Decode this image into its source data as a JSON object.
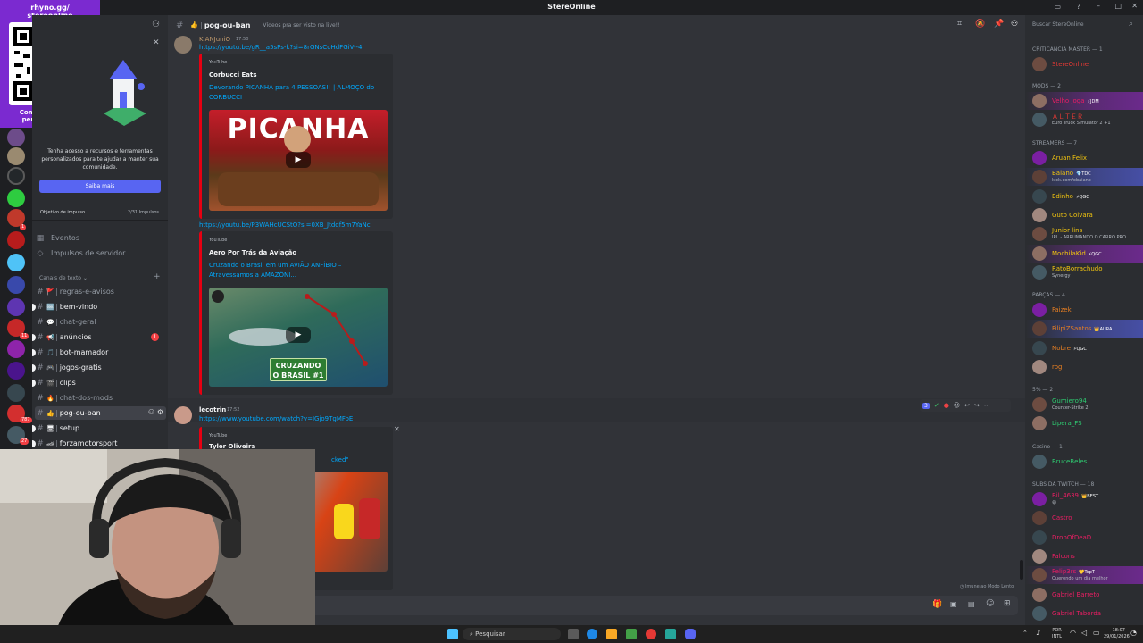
{
  "window": {
    "title": "StereOnline"
  },
  "qr": {
    "line1": "rhyno.gg/",
    "line2": "stereonline",
    "cta": "Compre produtos personalizados!"
  },
  "server_badges": [
    "1",
    "11",
    "787",
    "27"
  ],
  "sidebar": {
    "promo_text": "Tenha acesso a recursos e ferramentas personalizados para te ajudar a manter sua comunidade.",
    "promo_button": "Saiba mais",
    "boost_goal_label": "Objetivo de impulso",
    "boost_goal_value": "2/31 Impulsos",
    "events": "Eventos",
    "server_boosts": "Impulsos de servidor",
    "category": "Canais de texto",
    "channels": [
      {
        "name": "regras-e-avisos",
        "emoji": "🚩",
        "state": "read"
      },
      {
        "name": "bem-vindo",
        "emoji": "🆒",
        "state": "unread"
      },
      {
        "name": "chat-geral",
        "emoji": "💬",
        "state": "read"
      },
      {
        "name": "anúncios",
        "emoji": "📢",
        "state": "unread",
        "badge": "1"
      },
      {
        "name": "bot-mamador",
        "emoji": "🎵",
        "state": "unread"
      },
      {
        "name": "jogos-gratis",
        "emoji": "🎮",
        "state": "unread"
      },
      {
        "name": "clips",
        "emoji": "🎬",
        "state": "unread"
      },
      {
        "name": "chat-dos-mods",
        "emoji": "🔥",
        "state": "read"
      },
      {
        "name": "pog-ou-ban",
        "emoji": "👍",
        "state": "active"
      },
      {
        "name": "setup",
        "emoji": "🖥",
        "state": "unread"
      },
      {
        "name": "forzamotorsport",
        "emoji": "🏎",
        "state": "unread"
      }
    ]
  },
  "header": {
    "channel": "pog-ou-ban",
    "topic": "Vídeos pra ser visto na live!!",
    "search_placeholder": "Buscar StereOnline"
  },
  "messages": [
    {
      "author": "KIANJuniO",
      "time": "17:50",
      "link1": "https://youtu.be/gR__a5sPs-k?si=8rGNsCoHdFGiV--4",
      "embed1": {
        "provider": "YouTube",
        "channel": "Corbucci Eats",
        "title": "Devorando PICANHA para 4 PESSOAS!! | ALMOÇO do CORBUCCI",
        "thumb_text": "PICANHA"
      },
      "link2": "https://youtu.be/P3WAHcUCStQ?si=0XB_Jtdqf5m7YaNc",
      "embed2": {
        "provider": "YouTube",
        "channel": "Aero Por Trás da Aviação",
        "title": "Cruzando o Brasil em um AVIÃO ANFÍBIO – Atravessamos a AMAZÔNI...",
        "thumb_text1": "CRUZANDO",
        "thumb_text2": "O BRASIL #1"
      }
    },
    {
      "author": "lecotrin",
      "time": "17:52",
      "link1": "https://www.youtube.com/watch?v=IGjo9TgMFoE",
      "embed1": {
        "provider": "YouTube",
        "channel": "Tyler Oliveira",
        "title_fragment": "cked\""
      }
    }
  ],
  "reaction_counter": "3",
  "slow_mode": "Imune ao Modo Lento",
  "members": {
    "sections": [
      {
        "label": "CRITICANCIA MASTER — 1",
        "members": [
          {
            "name": "StereOnline",
            "color": "#e53935"
          }
        ]
      },
      {
        "label": "MODS — 2",
        "members": [
          {
            "name": "Velho Joga",
            "color": "#e91e63",
            "badge": "⚡JDM",
            "style": "boostp"
          },
          {
            "name": "ＡＬＴＥＲ",
            "color": "#e53935",
            "status": "Euro Truck Simulator 2 +1"
          }
        ]
      },
      {
        "label": "STREAMERS — 7",
        "members": [
          {
            "name": "Aruan Felix",
            "color": "#f1c40f"
          },
          {
            "name": "Baiano",
            "color": "#f1c40f",
            "badge": "💎TDC",
            "status": "kick.com/obaiano",
            "style": "boost"
          },
          {
            "name": "Edinho",
            "color": "#f1c40f",
            "badge": "⚡QGC"
          },
          {
            "name": "Guto Colvara",
            "color": "#f1c40f"
          },
          {
            "name": "Junior lins",
            "color": "#f1c40f",
            "status": "IRL - ARRUMANDO O CARRO PRO"
          },
          {
            "name": "MochilaKid",
            "color": "#f1c40f",
            "badge": "⚡QGC",
            "style": "boostp"
          },
          {
            "name": "RatoBorrachudo",
            "color": "#f1c40f",
            "status": "Synergy"
          }
        ]
      },
      {
        "label": "PARÇAS — 4",
        "members": [
          {
            "name": "Faizeki",
            "color": "#e67e22"
          },
          {
            "name": "FilipiZSantos",
            "color": "#e67e22",
            "badge": "👑AURA",
            "style": "boost"
          },
          {
            "name": "Nobre",
            "color": "#e67e22",
            "badge": "⚡QGC"
          },
          {
            "name": "rog",
            "color": "#e67e22"
          }
        ]
      },
      {
        "label": "5% — 2",
        "members": [
          {
            "name": "Gumiero94",
            "color": "#2ecc71",
            "status": "Counter-Strike 2"
          },
          {
            "name": "Lipera_FS",
            "color": "#2ecc71"
          }
        ]
      },
      {
        "label": "Casino — 1",
        "members": [
          {
            "name": "BruceBeles",
            "color": "#2ecc71"
          }
        ]
      },
      {
        "label": "SUBS DA TWITCH — 18",
        "members": [
          {
            "name": "Bil_4639",
            "color": "#e91e63",
            "badge": "👑BEST",
            "status": "😄"
          },
          {
            "name": "Castro",
            "color": "#e91e63"
          },
          {
            "name": "DropOfDeaD",
            "color": "#e91e63"
          },
          {
            "name": "Falcons",
            "color": "#e91e63"
          },
          {
            "name": "Felip3rs",
            "color": "#e91e63",
            "badge": "💛TopT",
            "status": "Querendo um dia melhor",
            "style": "boostp"
          },
          {
            "name": "Gabriel Barreto",
            "color": "#e91e63"
          },
          {
            "name": "Gabriel Taborda",
            "color": "#e91e63"
          }
        ]
      }
    ]
  },
  "taskbar": {
    "search": "Pesquisar",
    "lang1": "POR",
    "lang2": "INTL",
    "time": "18:07",
    "date": "29/01/2026"
  }
}
